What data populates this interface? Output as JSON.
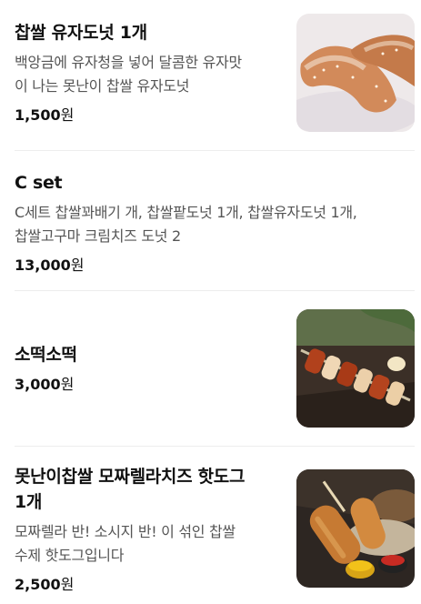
{
  "menu": {
    "items": [
      {
        "name": "찹쌀 유자도넛 1개",
        "description_lines": [
          "백앙금에 유자청을 넣어 달콤한 유자맛",
          "이 나는 못난이 찹쌀 유자도넛"
        ],
        "price": "1,500",
        "currency": "원",
        "image": "citron-donut-photo"
      },
      {
        "name": "C set",
        "description_lines": [
          "C세트 찹쌀꽈배기 개, 찹쌀팥도넛 1개, 찹쌀유자도넛 1개,",
          "찹쌀고구마 크림치즈 도넛 2"
        ],
        "price": "13,000",
        "currency": "원",
        "image": null
      },
      {
        "name": "소떡소떡",
        "description_lines": [],
        "price": "3,000",
        "currency": "원",
        "image": "sotteok-skewer-photo"
      },
      {
        "name_lines": [
          "못난이찹쌀 모짜렐라치즈 핫도그",
          "1개"
        ],
        "description_lines": [
          "모짜렐라 반! 소시지 반! 이 섞인 찹쌀",
          "수제 핫도그입니다"
        ],
        "price": "2,500",
        "currency": "원",
        "image": "hotdog-photo"
      }
    ]
  }
}
